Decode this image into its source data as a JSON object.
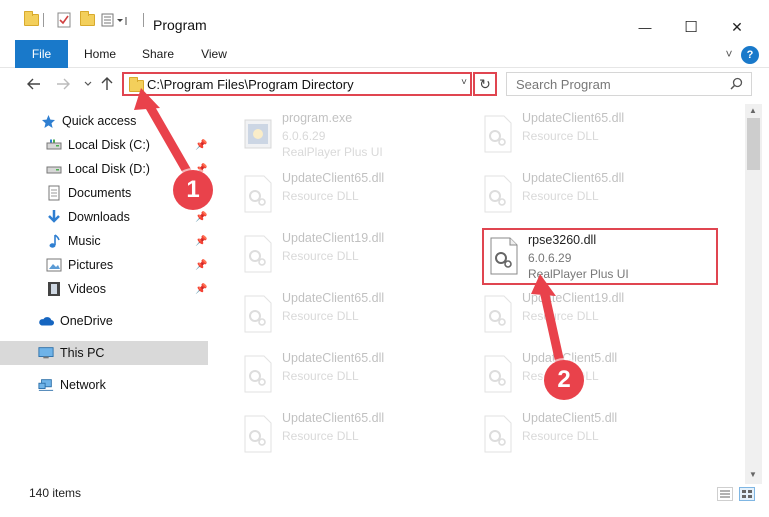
{
  "window": {
    "title": "Program",
    "minimize": "—",
    "maximize": "☐",
    "close": "✕"
  },
  "ribbon": {
    "tabs": [
      "File",
      "Home",
      "Share",
      "View"
    ],
    "expand": "˅",
    "help": "?"
  },
  "address": {
    "path": "C:\\Program Files\\Program Directory",
    "refresh": "↻",
    "dropdown": "˅"
  },
  "search": {
    "placeholder": "Search Program"
  },
  "sidebar": {
    "items": [
      {
        "label": "Quick access",
        "icon": "star-icon",
        "pinned": false
      },
      {
        "label": "Local Disk (C:)",
        "icon": "drive-icon",
        "pinned": true
      },
      {
        "label": "Local Disk (D:)",
        "icon": "drive-icon",
        "pinned": true
      },
      {
        "label": "Documents",
        "icon": "documents-icon",
        "pinned": true
      },
      {
        "label": "Downloads",
        "icon": "download-icon",
        "pinned": true
      },
      {
        "label": "Music",
        "icon": "music-icon",
        "pinned": true
      },
      {
        "label": "Pictures",
        "icon": "pictures-icon",
        "pinned": true
      },
      {
        "label": "Videos",
        "icon": "videos-icon",
        "pinned": true
      },
      {
        "label": "OneDrive",
        "icon": "cloud-icon",
        "pinned": false
      },
      {
        "label": "This PC",
        "icon": "computer-icon",
        "pinned": false,
        "selected": true
      },
      {
        "label": "Network",
        "icon": "network-icon",
        "pinned": false
      }
    ]
  },
  "files": [
    {
      "name": "program.exe",
      "line2": "6.0.6.29",
      "line3": "RealPlayer Plus UI",
      "faded": true
    },
    {
      "name": "UpdateClient65.dll",
      "line2": "Resource DLL",
      "faded": true
    },
    {
      "name": "UpdateClient65.dll",
      "line2": "Resource DLL",
      "faded": true
    },
    {
      "name": "UpdateClient65.dll",
      "line2": "Resource DLL",
      "faded": true
    },
    {
      "name": "UpdateClient19.dll",
      "line2": "Resource DLL",
      "faded": true
    },
    {
      "name": "rpse3260.dll",
      "line2": "6.0.6.29",
      "line3": "RealPlayer Plus UI",
      "faded": false
    },
    {
      "name": "UpdateClient65.dll",
      "line2": "Resource DLL",
      "faded": true
    },
    {
      "name": "UpdateClient19.dll",
      "line2": "Resource DLL",
      "faded": true
    },
    {
      "name": "UpdateClient65.dll",
      "line2": "Resource DLL",
      "faded": true
    },
    {
      "name": "UpdateClient5.dll",
      "line2": "Resource DLL",
      "faded": true
    },
    {
      "name": "UpdateClient65.dll",
      "line2": "Resource DLL",
      "faded": true
    },
    {
      "name": "UpdateClient5.dll",
      "line2": "Resource DLL",
      "faded": true
    }
  ],
  "status": {
    "items": "140 items"
  },
  "annotations": {
    "step1": "1",
    "step2": "2"
  },
  "colors": {
    "accent": "#1979ca",
    "highlight": "#e04550",
    "callout": "#e9424b"
  }
}
